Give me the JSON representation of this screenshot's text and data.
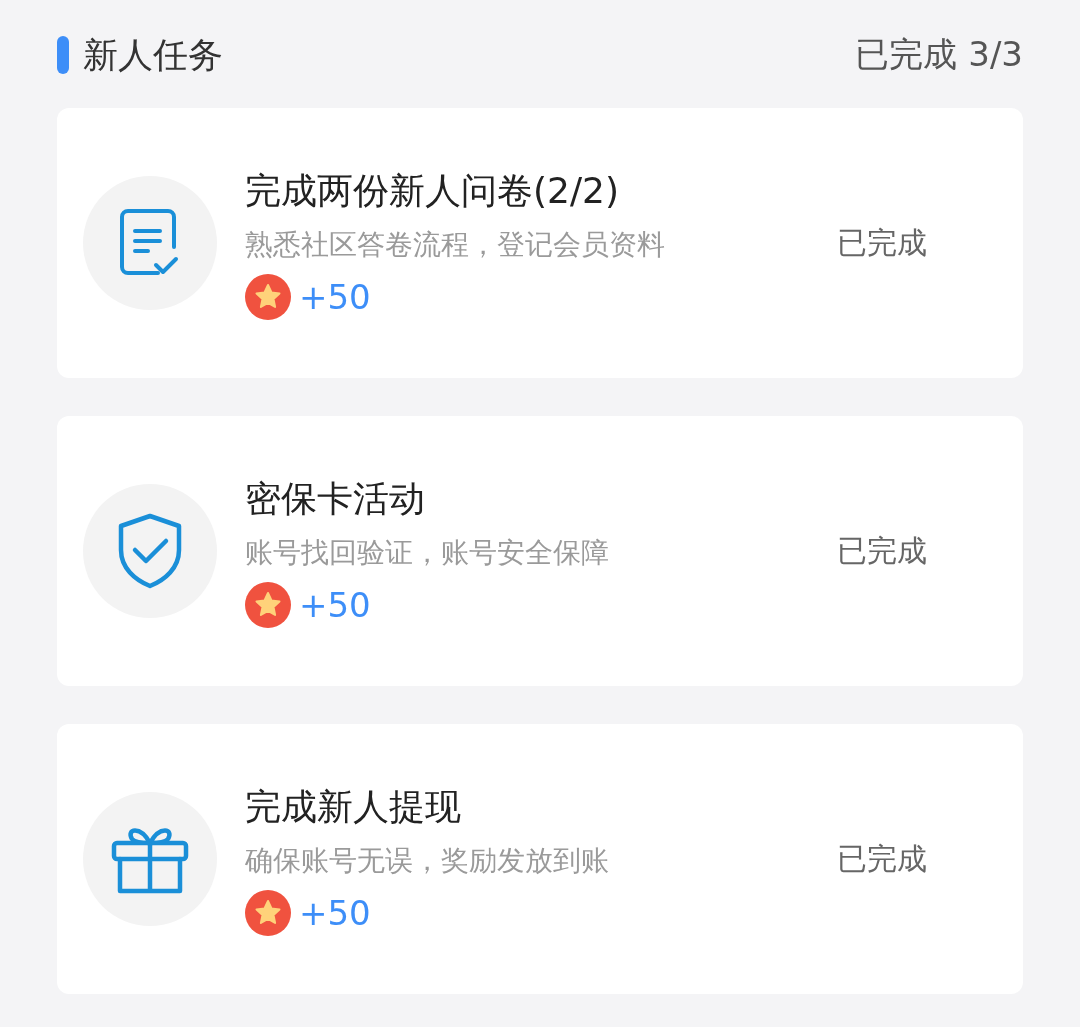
{
  "header": {
    "title": "新人任务",
    "progress": "已完成 3/3"
  },
  "tasks": [
    {
      "kind": "survey",
      "title": "完成两份新人问卷(2/2)",
      "description": "熟悉社区答卷流程，登记会员资料",
      "reward": "+50",
      "status": "已完成"
    },
    {
      "kind": "shield",
      "title": "密保卡活动",
      "description": "账号找回验证，账号安全保障",
      "reward": "+50",
      "status": "已完成"
    },
    {
      "kind": "gift",
      "title": "完成新人提现",
      "description": "确保账号无误，奖励发放到账",
      "reward": "+50",
      "status": "已完成"
    }
  ]
}
